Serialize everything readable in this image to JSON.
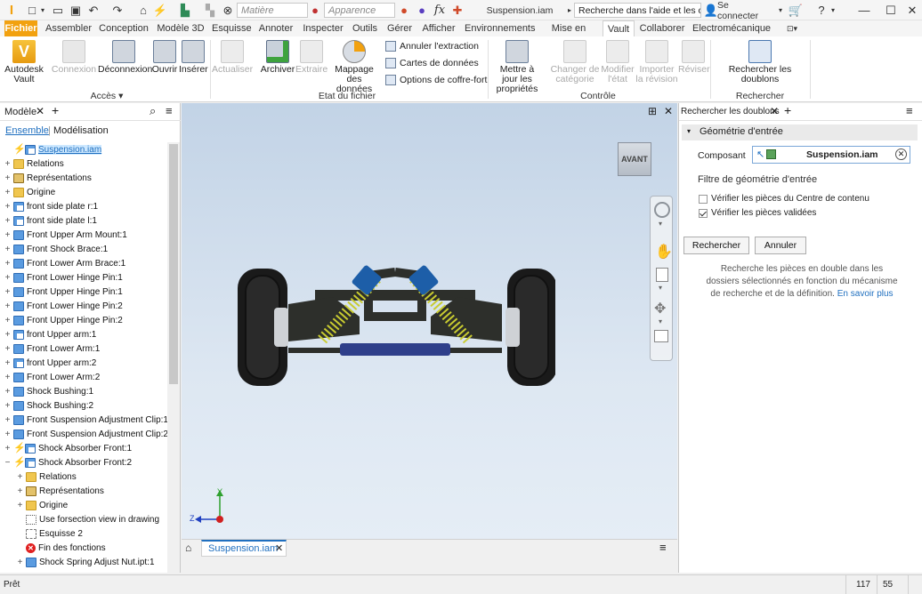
{
  "qat": {
    "material_placeholder": "Matière",
    "appearance_placeholder": "Apparence",
    "fx": "fx",
    "document_title": "Suspension.iam",
    "help_search": "Recherche dans l'aide et les com",
    "sign_in": "Se connecter"
  },
  "tabs": [
    "Fichier",
    "Assembler",
    "Conception",
    "Modèle 3D",
    "Esquisse",
    "Annoter",
    "Inspecter",
    "Outils",
    "Gérer",
    "Afficher",
    "Environnements",
    "Mise en route",
    "Vault",
    "Collaborer",
    "Electromécanique"
  ],
  "active_tab": "Vault",
  "ribbon": {
    "autodesk_vault": "Autodesk Vault",
    "connexion": "Connexion",
    "deconnexion": "Déconnexion",
    "ouvrir": "Ouvrir",
    "inserer": "Insérer",
    "acces": "Accès",
    "actualiser": "Actualiser",
    "archiver": "Archiver",
    "extraire": "Extraire",
    "mappage": "Mappage des données",
    "annuler_extraction": "Annuler l'extraction",
    "cartes_donnees": "Cartes de données",
    "options_coffre": "Options de coffre-fort",
    "etat_fichier": "Etat du fichier",
    "mettre_a_jour": "Mettre à jour les propriétés",
    "changer_categorie": "Changer de catégorie",
    "modifier_etat": "Modifier l'état",
    "importer_revision": "Importer la révision",
    "reviser": "Réviser",
    "controle": "Contrôle",
    "rechercher_doublons": "Rechercher les doublons",
    "rechercher": "Rechercher"
  },
  "model_panel": {
    "title": "Modèle",
    "view_ensemble": "Ensemble",
    "view_modelisation": "Modélisation",
    "tree": [
      {
        "label": "Suspension.iam",
        "icon": "bolt-asm",
        "level": 0,
        "exp": ""
      },
      {
        "label": "Relations",
        "icon": "folder",
        "level": 0,
        "exp": "+"
      },
      {
        "label": "Représentations",
        "icon": "rep",
        "level": 0,
        "exp": "+"
      },
      {
        "label": "Origine",
        "icon": "folder",
        "level": 0,
        "exp": "+"
      },
      {
        "label": "front side plate r:1",
        "icon": "asm",
        "level": 0,
        "exp": "+"
      },
      {
        "label": "front side plate l:1",
        "icon": "asm",
        "level": 0,
        "exp": "+"
      },
      {
        "label": "Front Upper Arm Mount:1",
        "icon": "part",
        "level": 0,
        "exp": "+"
      },
      {
        "label": "Front Shock Brace:1",
        "icon": "part",
        "level": 0,
        "exp": "+"
      },
      {
        "label": "Front Lower Arm Brace:1",
        "icon": "part",
        "level": 0,
        "exp": "+"
      },
      {
        "label": "Front Lower Hinge Pin:1",
        "icon": "part",
        "level": 0,
        "exp": "+"
      },
      {
        "label": "Front Upper Hinge Pin:1",
        "icon": "part",
        "level": 0,
        "exp": "+"
      },
      {
        "label": "Front Lower Hinge Pin:2",
        "icon": "part",
        "level": 0,
        "exp": "+"
      },
      {
        "label": "Front Upper Hinge Pin:2",
        "icon": "part",
        "level": 0,
        "exp": "+"
      },
      {
        "label": "front Upper arm:1",
        "icon": "asm",
        "level": 0,
        "exp": "+"
      },
      {
        "label": "Front Lower Arm:1",
        "icon": "part",
        "level": 0,
        "exp": "+"
      },
      {
        "label": "front Upper arm:2",
        "icon": "asm",
        "level": 0,
        "exp": "+"
      },
      {
        "label": "Front Lower Arm:2",
        "icon": "part",
        "level": 0,
        "exp": "+"
      },
      {
        "label": "Shock Bushing:1",
        "icon": "part",
        "level": 0,
        "exp": "+"
      },
      {
        "label": "Shock Bushing:2",
        "icon": "part",
        "level": 0,
        "exp": "+"
      },
      {
        "label": "Front Suspension Adjustment Clip:1",
        "icon": "part",
        "level": 0,
        "exp": "+"
      },
      {
        "label": "Front Suspension Adjustment Clip:2",
        "icon": "part",
        "level": 0,
        "exp": "+"
      },
      {
        "label": "Shock Absorber Front:1",
        "icon": "bolt-asm",
        "level": 0,
        "exp": "+"
      },
      {
        "label": "Shock Absorber Front:2",
        "icon": "bolt-asm",
        "level": 0,
        "exp": "−"
      },
      {
        "label": "Relations",
        "icon": "folder",
        "level": 1,
        "exp": "+"
      },
      {
        "label": "Représentations",
        "icon": "rep",
        "level": 1,
        "exp": "+"
      },
      {
        "label": "Origine",
        "icon": "folder",
        "level": 1,
        "exp": "+"
      },
      {
        "label": "Use forsection view in drawing",
        "icon": "view",
        "level": 1,
        "exp": ""
      },
      {
        "label": "Esquisse 2",
        "icon": "sketch",
        "level": 1,
        "exp": ""
      },
      {
        "label": "Fin des fonctions",
        "icon": "err",
        "level": 1,
        "exp": ""
      },
      {
        "label": "Shock Spring Adjust Nut.ipt:1",
        "icon": "part",
        "level": 1,
        "exp": "+"
      }
    ]
  },
  "viewport": {
    "viewcube_label": "AVANT",
    "doc_tab": "Suspension.iam",
    "axis_y": "Y",
    "axis_z": "Z"
  },
  "right_panel": {
    "title": "Rechercher les doublons",
    "section": "Géométrie d'entrée",
    "component_label": "Composant",
    "component_value": "Suspension.iam",
    "filter_title": "Filtre de géométrie d'entrée",
    "check1": "Vérifier les pièces du Centre de contenu",
    "check1_on": false,
    "check2": "Vérifier les pièces validées",
    "check2_on": true,
    "search_btn": "Rechercher",
    "cancel_btn": "Annuler",
    "desc": "Recherche les pièces en double dans les dossiers sélectionnés en fonction du mécanisme de recherche et de la définition.",
    "link": "En savoir plus"
  },
  "status": {
    "text": "Prêt",
    "num1": "117",
    "num2": "55"
  },
  "colors": {
    "file_tab": "#f2a10f",
    "accent_blue": "#1f6fbf",
    "selection": "#cde8ff"
  }
}
